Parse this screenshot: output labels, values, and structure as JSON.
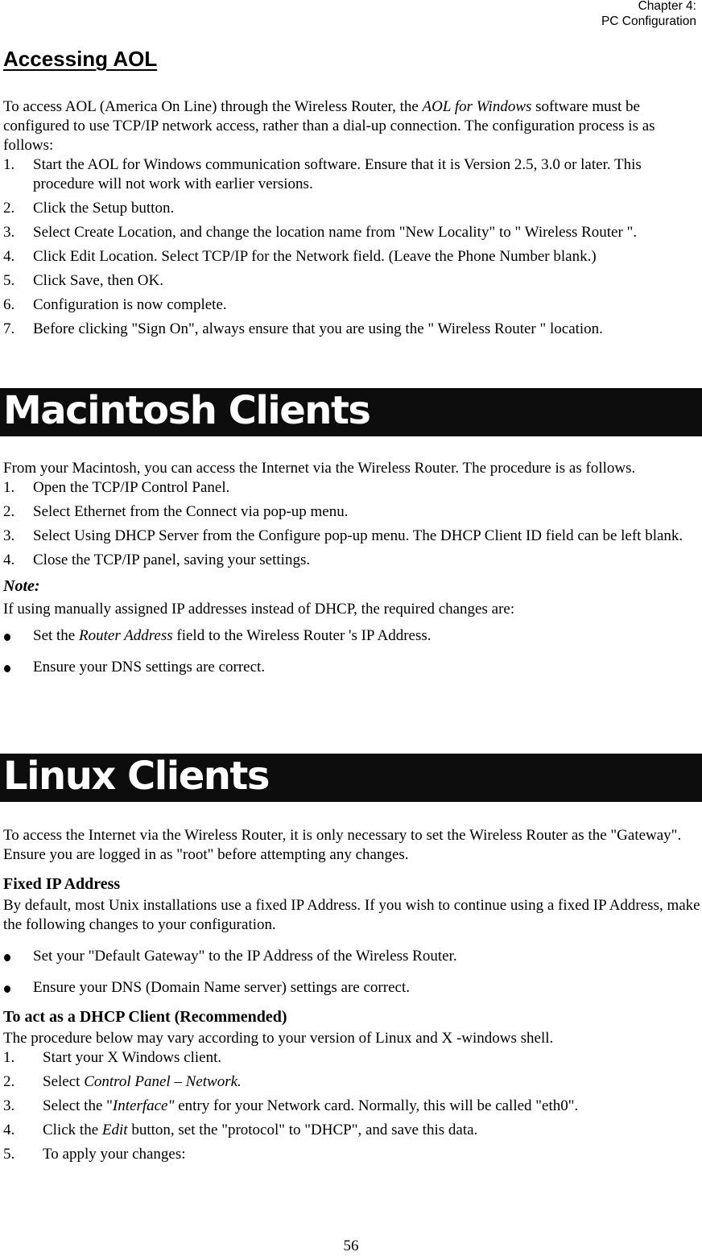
{
  "header": {
    "chapter": "Chapter 4:",
    "section": "PC Configuration"
  },
  "aol": {
    "title": "Accessing AOL",
    "intro_a": "To access AOL (America On Line) through the Wireless Router, the ",
    "intro_italic": "AOL for Windows",
    "intro_b": " software must be configured to use TCP/IP network access, rather than a dial-up connection. The configuration process is as follows:",
    "steps": [
      {
        "num": "1.",
        "text": "Start the AOL for Windows communication software. Ensure that it is Version 2.5, 3.0 or later. This procedure will not work with earlier versions."
      },
      {
        "num": "2.",
        "text": "Click the Setup button."
      },
      {
        "num": "3.",
        "text": "Select Create Location, and change the location name from \"New Locality\" to \" Wireless Router \"."
      },
      {
        "num": "4.",
        "text": "Click Edit Location. Select TCP/IP for the Network field. (Leave the Phone Number blank.)"
      },
      {
        "num": "5.",
        "text": "Click Save, then OK."
      },
      {
        "num": "6.",
        "text": "Configuration is now complete."
      },
      {
        "num": "7.",
        "text": "Before clicking \"Sign On\", always ensure that you are using the \" Wireless Router \" location."
      }
    ]
  },
  "mac": {
    "title": "Macintosh Clients",
    "intro": "From your Macintosh, you can access the Internet via the Wireless Router. The procedure is as follows.",
    "steps": [
      {
        "num": "1.",
        "text": "Open the TCP/IP Control Panel."
      },
      {
        "num": "2.",
        "text": "Select Ethernet from the Connect via pop-up menu."
      },
      {
        "num": "3.",
        "text": "Select Using DHCP Server from the Configure pop-up menu. The DHCP Client ID field can be left blank."
      },
      {
        "num": "4.",
        "text": "Close the TCP/IP panel, saving your settings."
      }
    ],
    "note_label": "Note:",
    "note_text": "If using manually assigned IP addresses instead of DHCP, the required changes are:",
    "bullet1_a": "Set the ",
    "bullet1_italic": "Router Address",
    "bullet1_b": " field to the Wireless Router 's IP Address.",
    "bullet2": "Ensure your DNS settings are correct."
  },
  "linux": {
    "title": "Linux Clients",
    "intro1": "To access the Internet via the Wireless Router, it is only necessary to set the Wireless Router as the \"Gateway\".",
    "intro2": "Ensure you are logged in as \"root\" before attempting any changes.",
    "fixed_heading": "Fixed IP Address",
    "fixed_text": "By default, most Unix installations use a fixed IP Address. If you wish to continue using a fixed IP Address, make the following changes to your configuration.",
    "fixed_bullets": [
      "Set your \"Default Gateway\" to the IP Address of the Wireless Router.",
      "Ensure your DNS (Domain Name server) settings are correct."
    ],
    "dhcp_heading": "To act as a DHCP Client (Recommended)",
    "dhcp_intro": "The procedure below may vary according to your version of Linux and X -windows shell.",
    "dhcp_steps": {
      "s1": {
        "num": "1.",
        "text": "Start your X Windows client."
      },
      "s2": {
        "num": "2.",
        "a": "Select ",
        "italic": "Control Panel – Network."
      },
      "s3": {
        "num": "3.",
        "a": "Select the \"",
        "italic": "Interface\"",
        "b": " entry for your Network card. Normally, this will be called \"eth0\"."
      },
      "s4": {
        "num": "4.",
        "a": "Click the ",
        "italic": "Edit",
        "b": " button, set the \"protocol\" to \"DHCP\", and save this data."
      },
      "s5": {
        "num": "5.",
        "text": "To apply your changes:"
      }
    }
  },
  "footer": {
    "page_number": "56"
  }
}
